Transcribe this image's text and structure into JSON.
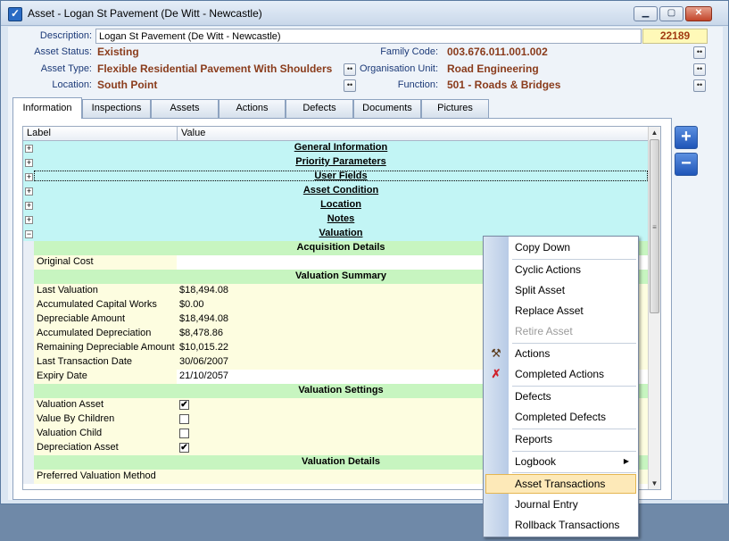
{
  "window": {
    "title": "Asset - Logan St Pavement (De Witt - Newcastle)",
    "controls": {
      "minimize": "▁",
      "maximize": "▢",
      "close": "✕"
    }
  },
  "header": {
    "description_label": "Description:",
    "description_value": "Logan St Pavement (De Witt - Newcastle)",
    "asset_id": "22189",
    "asset_status_label": "Asset Status:",
    "asset_status_value": "Existing",
    "family_code_label": "Family Code:",
    "family_code_value": "003.676.011.001.002",
    "asset_type_label": "Asset Type:",
    "asset_type_value": "Flexible Residential Pavement With Shoulders",
    "organisation_unit_label": "Organisation Unit:",
    "organisation_unit_value": "Road Engineering",
    "location_label": "Location:",
    "location_value": "South Point",
    "function_label": "Function:",
    "function_value": "501 - Roads & Bridges",
    "lookup_glyph": "••"
  },
  "tabs": [
    "Information",
    "Inspections",
    "Assets",
    "Actions",
    "Defects",
    "Documents",
    "Pictures"
  ],
  "grid": {
    "col_label": "Label",
    "col_value": "Value",
    "expand_glyph": "+",
    "collapse_glyph": "−",
    "sections": [
      "General Information",
      "Priority Parameters",
      "User Fields",
      "Asset Condition",
      "Location",
      "Notes",
      "Valuation"
    ],
    "acquisition": {
      "title": "Acquisition Details",
      "original_cost_label": "Original Cost",
      "original_cost_value": ""
    },
    "summary": {
      "title": "Valuation Summary",
      "rows": [
        {
          "label": "Last Valuation",
          "value": "$18,494.08"
        },
        {
          "label": "Accumulated Capital Works",
          "value": "$0.00"
        },
        {
          "label": "Depreciable Amount",
          "value": "$18,494.08"
        },
        {
          "label": "Accumulated Depreciation",
          "value": "$8,478.86"
        },
        {
          "label": "Remaining Depreciable Amount",
          "value": "$10,015.22"
        },
        {
          "label": "Last Transaction Date",
          "value": "30/06/2007"
        },
        {
          "label": "Expiry Date",
          "value": "21/10/2057"
        }
      ]
    },
    "settings": {
      "title": "Valuation Settings",
      "rows": [
        {
          "label": "Valuation Asset",
          "checked": "✔"
        },
        {
          "label": "Value By Children",
          "checked": ""
        },
        {
          "label": "Valuation Child",
          "checked": ""
        },
        {
          "label": "Depreciation Asset",
          "checked": "✔"
        }
      ]
    },
    "details": {
      "title": "Valuation Details",
      "preferred_method_label": "Preferred Valuation Method",
      "preferred_method_value": ""
    }
  },
  "side_buttons": {
    "add": "+",
    "remove": "−"
  },
  "scrollbar": {
    "up": "▲",
    "down": "▼",
    "grip": "≡"
  },
  "context_menu": {
    "items": [
      {
        "label": "Copy Down",
        "disabled": false
      },
      {
        "label": "Cyclic Actions",
        "disabled": false
      },
      {
        "label": "Split Asset",
        "disabled": false
      },
      {
        "label": "Replace Asset",
        "disabled": false
      },
      {
        "label": "Retire Asset",
        "disabled": true
      },
      {
        "label": "Actions",
        "icon": "hammer-icon"
      },
      {
        "label": "Completed Actions",
        "icon": "hammer-cross-icon"
      },
      {
        "label": "Defects"
      },
      {
        "label": "Completed Defects"
      },
      {
        "label": "Reports"
      },
      {
        "label": "Logbook",
        "submenu": "▶"
      },
      {
        "label": "Asset Transactions",
        "highlighted": true
      },
      {
        "label": "Journal Entry"
      },
      {
        "label": "Rollback Transactions"
      }
    ],
    "icon_glyphs": {
      "actions": "⚒",
      "completed_actions": "✗"
    }
  },
  "colors": {
    "section_bg": "#c2f5f5",
    "subsection_bg": "#c7f5c0",
    "field_bg": "#fdfde0",
    "value_text": "#8a3c1c",
    "label_text": "#1c3a78",
    "highlight": "#fde9b8"
  }
}
